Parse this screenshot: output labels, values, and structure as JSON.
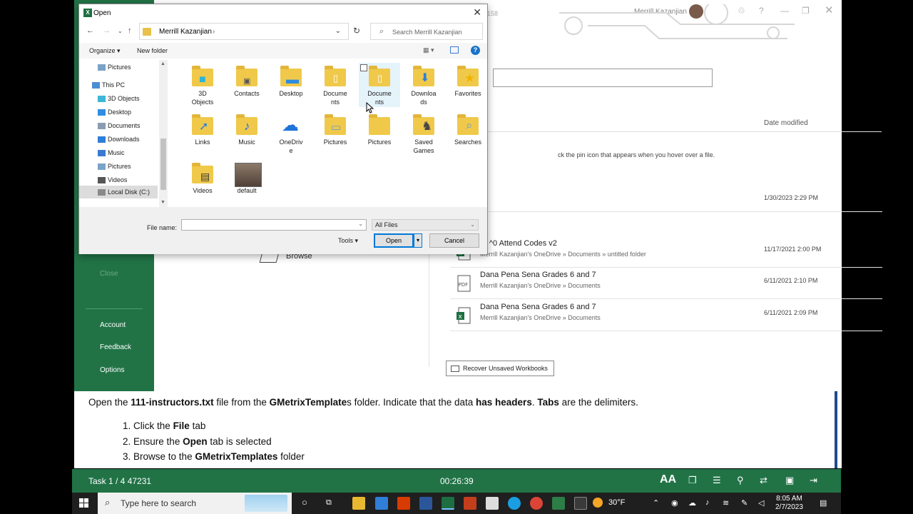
{
  "excel": {
    "user_name": "Merrill Kazanjian",
    "nav": {
      "close": "Close",
      "account": "Account",
      "feedback": "Feedback",
      "options": "Options"
    },
    "browse": "Browse",
    "date_modified_header": "Date modified",
    "pin_tip": "ck the pin icon that appears when you hover over a file.",
    "first_date": "1/30/2023 2:29 PM",
    "recent_files": [
      {
        "name": "ar ^0 Attend Codes v2",
        "path": "Merrill Kazanjian's OneDrive » Documents » untitled folder",
        "date": "11/17/2021 2:00 PM",
        "icon": "excel-file-icon"
      },
      {
        "name": "Dana Pena Sena Grades 6 and 7",
        "path": "Merrill Kazanjian's OneDrive » Documents",
        "date": "6/11/2021 2:10 PM",
        "icon": "pdf-file-icon"
      },
      {
        "name": "Dana Pena Sena Grades 6 and 7",
        "path": "Merrill Kazanjian's OneDrive » Documents",
        "date": "6/11/2021 2:09 PM",
        "icon": "excel-file-icon"
      }
    ],
    "recover_button": "Recover Unsaved Workbooks",
    "hidden_num": "158"
  },
  "dialog": {
    "title": "Open",
    "address": "Merrill Kazanjian",
    "search_placeholder": "Search Merrill Kazanjian",
    "organize": "Organize",
    "new_folder": "New folder",
    "tree": [
      {
        "label": "Pictures",
        "icon": "pictures-icon"
      },
      {
        "label": "This PC",
        "icon": "computer-icon"
      },
      {
        "label": "3D Objects",
        "icon": "3d-objects-icon"
      },
      {
        "label": "Desktop",
        "icon": "desktop-icon"
      },
      {
        "label": "Documents",
        "icon": "documents-icon"
      },
      {
        "label": "Downloads",
        "icon": "downloads-icon"
      },
      {
        "label": "Music",
        "icon": "music-icon"
      },
      {
        "label": "Pictures",
        "icon": "pictures-icon"
      },
      {
        "label": "Videos",
        "icon": "videos-icon"
      },
      {
        "label": "Local Disk (C:)",
        "icon": "disk-icon"
      }
    ],
    "items": [
      {
        "l1": "3D",
        "l2": "Objects",
        "icon": "3d-objects-folder-icon"
      },
      {
        "l1": "Contacts",
        "l2": "",
        "icon": "contacts-folder-icon"
      },
      {
        "l1": "Desktop",
        "l2": "",
        "icon": "desktop-folder-icon"
      },
      {
        "l1": "Docume",
        "l2": "nts",
        "icon": "documents-folder-icon"
      },
      {
        "l1": "Docume",
        "l2": "nts",
        "icon": "documents-folder-icon"
      },
      {
        "l1": "Downloa",
        "l2": "ds",
        "icon": "downloads-folder-icon"
      },
      {
        "l1": "Favorites",
        "l2": "",
        "icon": "favorites-folder-icon"
      },
      {
        "l1": "Links",
        "l2": "",
        "icon": "links-folder-icon"
      },
      {
        "l1": "Music",
        "l2": "",
        "icon": "music-folder-icon"
      },
      {
        "l1": "OneDriv",
        "l2": "e",
        "icon": "onedrive-folder-icon"
      },
      {
        "l1": "Pictures",
        "l2": "",
        "icon": "pictures-folder-icon"
      },
      {
        "l1": "Pictures",
        "l2": "",
        "icon": "pictures-folder-icon"
      },
      {
        "l1": "Saved",
        "l2": "Games",
        "icon": "saved-games-folder-icon"
      },
      {
        "l1": "Searches",
        "l2": "",
        "icon": "searches-folder-icon"
      },
      {
        "l1": "Videos",
        "l2": "",
        "icon": "videos-folder-icon"
      },
      {
        "l1": "default",
        "l2": "",
        "icon": "default-image-icon"
      }
    ],
    "file_name_label": "File name:",
    "file_name_value": "",
    "file_type": "All Files",
    "tools": "Tools",
    "open_button": "Open",
    "cancel_button": "Cancel"
  },
  "instructions": {
    "main_parts": [
      "Open the ",
      "111-instructors.txt",
      " file from the ",
      "GMetrixTemplate",
      "s folder. Indicate that the data ",
      "has headers",
      ". ",
      "Tabs",
      " are the delimiters."
    ],
    "steps": [
      {
        "n": "1.",
        "pre": "Click the ",
        "bold": "File",
        "post": " tab"
      },
      {
        "n": "2.",
        "pre": "Ensure the ",
        "bold": "Open",
        "post": " tab is selected"
      },
      {
        "n": "3.",
        "pre": "Browse to the ",
        "bold": "GMetrixTemplates",
        "post": " folder"
      }
    ]
  },
  "task_bar": {
    "task": "Task 1 / 4  47231",
    "timer": "00:26:39"
  },
  "windows": {
    "search": "Type here to search",
    "weather": "30°F",
    "time": "8:05 AM",
    "date": "2/7/2023"
  }
}
